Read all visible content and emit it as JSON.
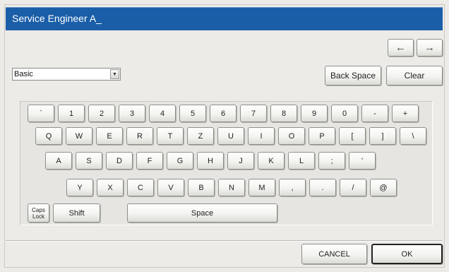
{
  "title": {
    "text": "Service Engineer A_"
  },
  "nav": {
    "left_icon": "left-arrow-icon",
    "right_icon": "right-arrow-icon",
    "left_glyph": "←",
    "right_glyph": "→"
  },
  "mode_select": {
    "value": "Basic"
  },
  "edit_buttons": {
    "backspace": "Back Space",
    "clear": "Clear"
  },
  "keyboard": {
    "row1": [
      "`",
      "1",
      "2",
      "3",
      "4",
      "5",
      "6",
      "7",
      "8",
      "9",
      "0",
      "-",
      "+"
    ],
    "row2": [
      "Q",
      "W",
      "E",
      "R",
      "T",
      "Z",
      "U",
      "I",
      "O",
      "P",
      "[",
      "]",
      "\\"
    ],
    "row3": [
      "A",
      "S",
      "D",
      "F",
      "G",
      "H",
      "J",
      "K",
      "L",
      ";",
      "'"
    ],
    "row4": [
      "Y",
      "X",
      "C",
      "V",
      "B",
      "N",
      "M",
      ",",
      ".",
      "/",
      "@"
    ],
    "caps_line1": "Caps",
    "caps_line2": "Lock",
    "shift": "Shift",
    "space": "Space"
  },
  "footer": {
    "cancel": "CANCEL",
    "ok": "OK"
  },
  "colors": {
    "title_bar": "#1a5ea8",
    "background": "#ecebe7"
  }
}
